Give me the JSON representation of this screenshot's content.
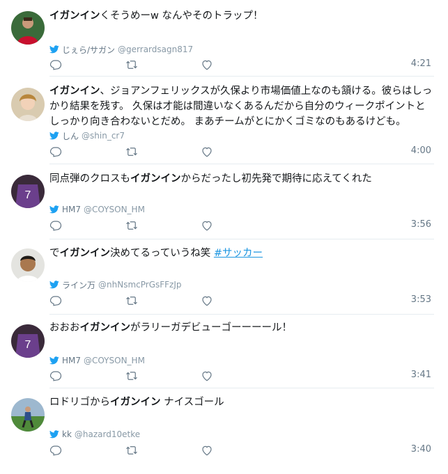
{
  "tweets": [
    {
      "segments": [
        {
          "t": "イガンイン",
          "b": true
        },
        {
          "t": "くそうめーw なんやそのトラップ！",
          "b": false
        }
      ],
      "name": "じぇら/サガン",
      "handle": "@gerrardsagn817",
      "time": "4:21"
    },
    {
      "segments": [
        {
          "t": "イガンイン",
          "b": true
        },
        {
          "t": "、ジョアンフェリックスが久保より市場価値上なのも頷ける。彼らはしっかり結果を残す。 久保は才能は間違いなくあるんだから自分のウィークポイントとしっかり向き合わないとだめ。 まあチームがとにかくゴミなのもあるけども。",
          "b": false
        }
      ],
      "name": "しん",
      "handle": "@shin_cr7",
      "time": "4:00"
    },
    {
      "segments": [
        {
          "t": "同点弾のクロスも",
          "b": false
        },
        {
          "t": "イガンイン",
          "b": true
        },
        {
          "t": "からだったし初先発で期待に応えてくれた",
          "b": false
        }
      ],
      "name": "HM7",
      "handle": "@COYSON_HM",
      "time": "3:56"
    },
    {
      "segments": [
        {
          "t": "で",
          "b": false
        },
        {
          "t": "イガンイン",
          "b": true
        },
        {
          "t": "決めてるっていうね笑 ",
          "b": false
        },
        {
          "t": "#サッカー",
          "b": false,
          "tag": true
        }
      ],
      "name": "ライン万",
      "handle": "@nhNsmcPrGsFFzJp",
      "time": "3:53"
    },
    {
      "segments": [
        {
          "t": "おおお",
          "b": false
        },
        {
          "t": "イガンイン",
          "b": true
        },
        {
          "t": "がラリーガデビューゴーーーール！",
          "b": false
        }
      ],
      "name": "HM7",
      "handle": "@COYSON_HM",
      "time": "3:41"
    },
    {
      "segments": [
        {
          "t": "ロドリゴから",
          "b": false
        },
        {
          "t": "イガンイン",
          "b": true
        },
        {
          "t": " ナイスゴール",
          "b": false
        }
      ],
      "name": "kk",
      "handle": "@hazard10etke",
      "time": "3:40"
    }
  ],
  "icons": {
    "source": "twitter-bird-icon",
    "reply": "reply-icon",
    "retweet": "retweet-icon",
    "like": "heart-icon"
  },
  "colors": {
    "twitter_blue": "#1da1f2",
    "hashtag": "#1b95e0",
    "muted": "#657786",
    "divider": "#e6ecf0"
  }
}
